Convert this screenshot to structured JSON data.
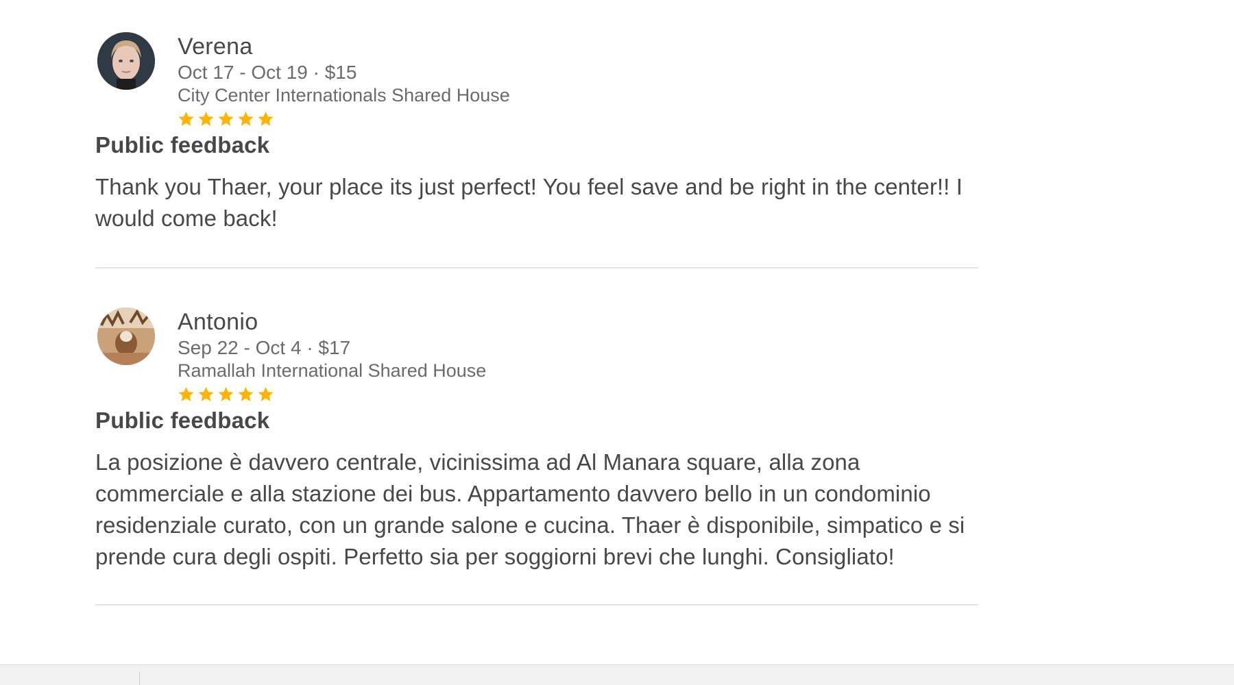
{
  "reviews": [
    {
      "name": "Verena",
      "stay": "Oct 17 - Oct 19 · $15",
      "listing": "City Center Internationals Shared House",
      "rating": 5,
      "feedback_heading": "Public feedback",
      "feedback": "Thank you Thaer, your place its just perfect! You feel save and be right in the center!! I would come back!"
    },
    {
      "name": "Antonio",
      "stay": "Sep 22 - Oct 4 · $17",
      "listing": "Ramallah International Shared House",
      "rating": 5,
      "feedback_heading": "Public feedback",
      "feedback": "La posizione è davvero centrale, vicinissima ad Al Manara square, alla zona commerciale e alla stazione dei bus. Appartamento davvero bello in un condominio residenziale curato, con un grande salone e cucina. Thaer è disponibile, simpatico e si prende cura degli ospiti.  Perfetto sia per soggiorni brevi che lunghi.  Consigliato!"
    }
  ],
  "colors": {
    "star": "#ffb400",
    "text": "#484848",
    "muted": "#6b6b6b",
    "divider": "#e4e4e4"
  }
}
